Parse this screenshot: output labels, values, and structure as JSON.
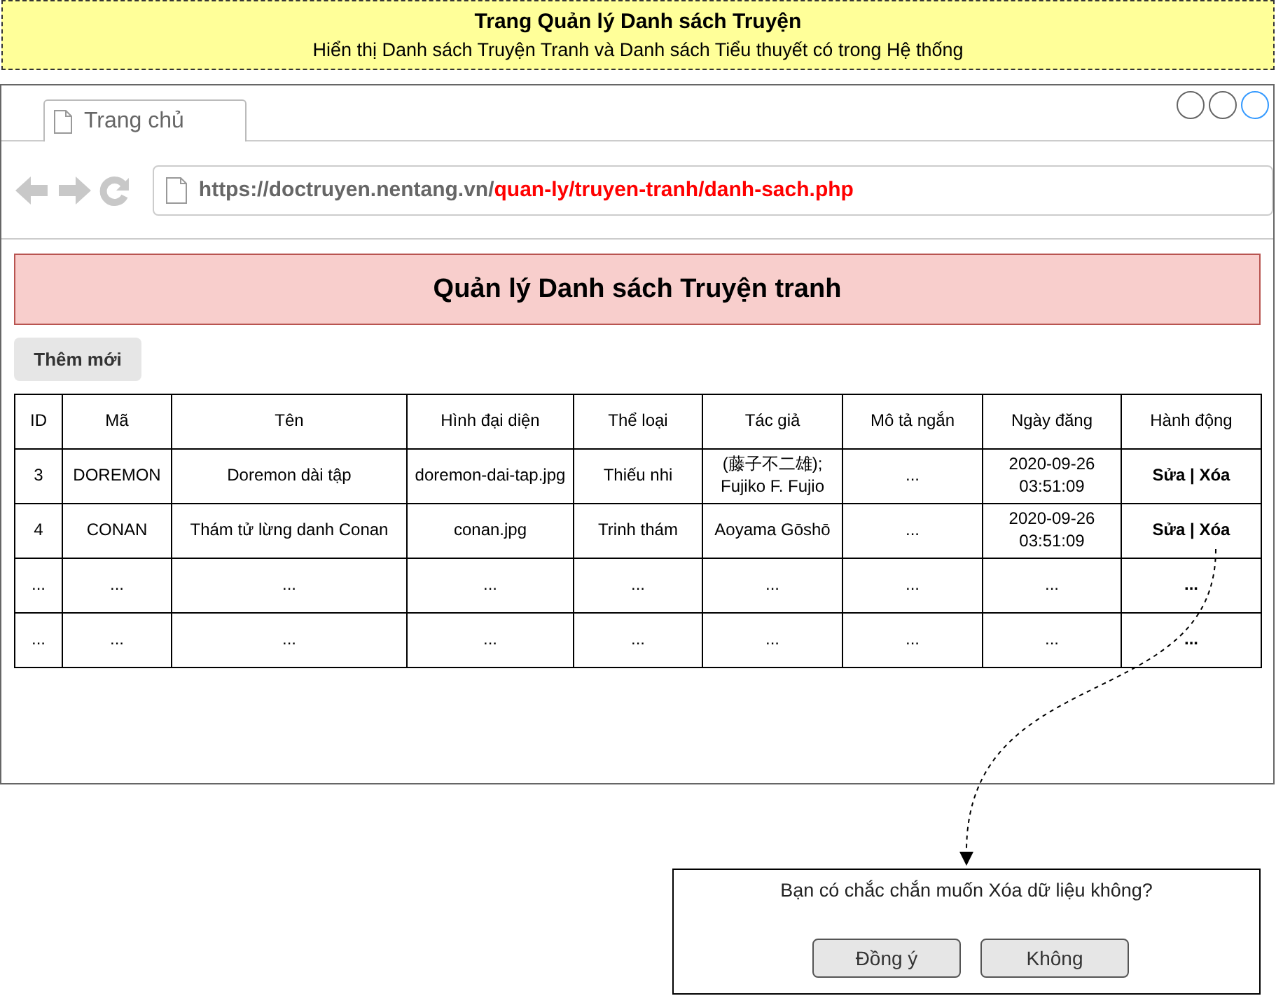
{
  "banner": {
    "title": "Trang Quản lý Danh sách Truyện",
    "subtitle": "Hiển thị Danh sách Truyện Tranh và Danh sách Tiểu thuyết có trong Hệ thống"
  },
  "browser": {
    "tab": {
      "label": "Trang chủ",
      "selected": true
    },
    "url": {
      "base": "https://doctruyen.nentang.vn/",
      "path": "quan-ly/truyen-tranh/danh-sach.php"
    }
  },
  "page": {
    "heading": "Quản lý Danh sách Truyện tranh",
    "add_button": "Thêm mới"
  },
  "table": {
    "columns": [
      {
        "label": "ID",
        "kind": "text"
      },
      {
        "label": "Mã",
        "kind": "text"
      },
      {
        "label": "Tên",
        "kind": "text"
      },
      {
        "label": "Hình đại diện",
        "kind": "text"
      },
      {
        "label": "Thể loại",
        "kind": "text"
      },
      {
        "label": "Tác giả",
        "kind": "text"
      },
      {
        "label": "Mô tả ngắn",
        "kind": "text"
      },
      {
        "label": "Ngày đăng",
        "kind": "text"
      },
      {
        "label": "Hành động",
        "kind": "action"
      }
    ],
    "rows": [
      {
        "cells": [
          "3",
          "DOREMON",
          "Doremon dài tập",
          "doremon-dai-tap.jpg",
          "Thiếu nhi",
          "(藤子不二雄); Fujiko F. Fujio",
          "...",
          "2020-09-26 03:51:09",
          "Sửa | Xóa"
        ]
      },
      {
        "cells": [
          "4",
          "CONAN",
          "Thám tử lừng danh Conan",
          "conan.jpg",
          "Trinh thám",
          "Aoyama Gōshō",
          "...",
          "2020-09-26 03:51:09",
          "Sửa | Xóa"
        ]
      },
      {
        "cells": [
          "...",
          "...",
          "...",
          "...",
          "...",
          "...",
          "...",
          "...",
          "..."
        ]
      },
      {
        "cells": [
          "...",
          "...",
          "...",
          "...",
          "...",
          "...",
          "...",
          "...",
          "..."
        ]
      }
    ]
  },
  "dialog": {
    "message": "Bạn có chắc chắn muốn Xóa dữ liệu không?",
    "buttons": [
      "Đồng ý",
      "Không"
    ]
  }
}
